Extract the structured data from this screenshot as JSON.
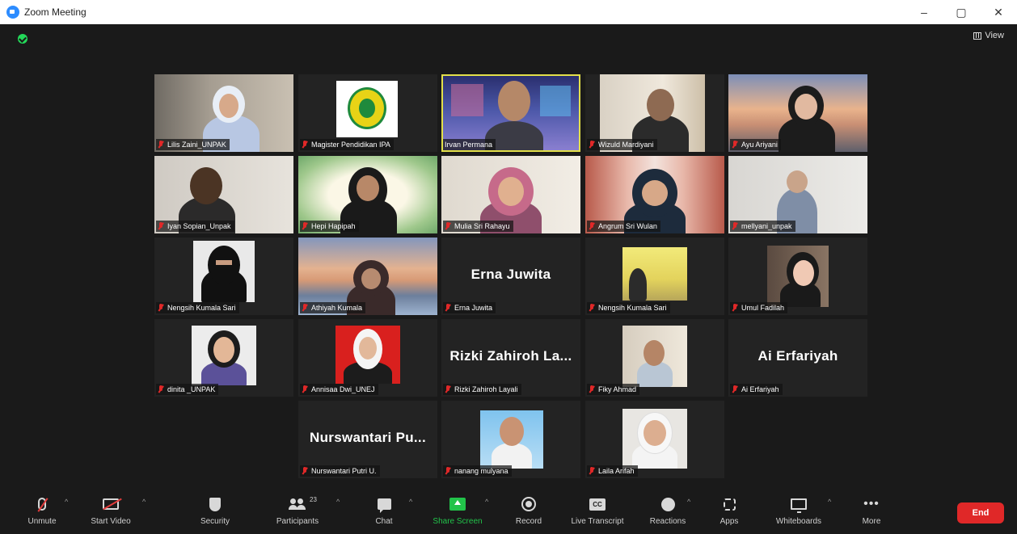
{
  "window": {
    "title": "Zoom Meeting",
    "minimize": "–",
    "restore": "▢",
    "close": "✕"
  },
  "meeting": {
    "view_label": "View"
  },
  "tiles": [
    {
      "name": "Lilis Zaini_UNPAK",
      "big_name": ""
    },
    {
      "name": "Magister Pendidikan IPA",
      "big_name": ""
    },
    {
      "name": "Irvan Permana",
      "big_name": ""
    },
    {
      "name": "Wizuld Mardiyani",
      "big_name": ""
    },
    {
      "name": "Ayu Ariyani",
      "big_name": ""
    },
    {
      "name": "Iyan Sopian_Unpak",
      "big_name": ""
    },
    {
      "name": "Hepi Hapipah",
      "big_name": ""
    },
    {
      "name": "Mulia Sri Rahayu",
      "big_name": ""
    },
    {
      "name": "Angrum Sri Wulan",
      "big_name": ""
    },
    {
      "name": "mellyani_unpak",
      "big_name": ""
    },
    {
      "name": "Nengsih Kumala Sari",
      "big_name": ""
    },
    {
      "name": "Athiyah Kumala",
      "big_name": ""
    },
    {
      "name": "Erna Juwita",
      "big_name": "Erna Juwita"
    },
    {
      "name": "Nengsih Kumala Sari",
      "big_name": ""
    },
    {
      "name": "Umul Fadilah",
      "big_name": ""
    },
    {
      "name": "dinita _UNPAK",
      "big_name": ""
    },
    {
      "name": "Annisaa Dwi_UNEJ",
      "big_name": ""
    },
    {
      "name": "Rizki Zahiroh Layali",
      "big_name": "Rizki Zahiroh La..."
    },
    {
      "name": "Fiky Ahmad",
      "big_name": ""
    },
    {
      "name": "Ai Erfariyah",
      "big_name": "Ai Erfariyah"
    },
    {
      "name": "Nurswantari Putri U.",
      "big_name": "Nurswantari Pu..."
    },
    {
      "name": "nanang mulyana",
      "big_name": ""
    },
    {
      "name": "Laila Arifah",
      "big_name": ""
    }
  ],
  "toolbar": {
    "unmute": "Unmute",
    "start_video": "Start Video",
    "security": "Security",
    "participants": "Participants",
    "participants_count": "23",
    "chat": "Chat",
    "share_screen": "Share Screen",
    "record": "Record",
    "live_transcript": "Live Transcript",
    "cc": "CC",
    "reactions": "Reactions",
    "apps": "Apps",
    "whiteboards": "Whiteboards",
    "more": "More",
    "more_glyph": "•••",
    "end": "End",
    "caret": "^"
  },
  "colors": {
    "accent": "#2d8cff",
    "share_green": "#22c34a",
    "end_red": "#e02828",
    "active_speaker": "#e3e04a",
    "background": "#1a1a1a"
  }
}
